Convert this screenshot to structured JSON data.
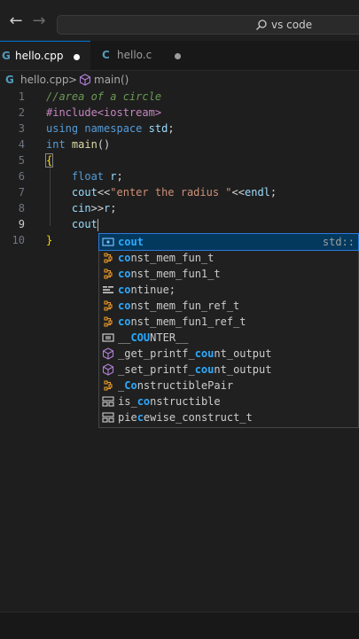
{
  "titlebar": {
    "search_text": "vs code"
  },
  "tabs": [
    {
      "icon": "C++ file icon",
      "label": "hello.cpp",
      "active": true,
      "modified": true
    },
    {
      "icon": "C file icon",
      "label": "hello.c",
      "active": false,
      "modified": true
    }
  ],
  "breadcrumb": {
    "file": "hello.cpp",
    "separator": ">",
    "symbol": "main()"
  },
  "editor": {
    "line_numbers": [
      "1",
      "2",
      "3",
      "4",
      "5",
      "6",
      "7",
      "8",
      "9",
      "10"
    ],
    "current_line": "9",
    "lines": [
      {
        "tokens": [
          {
            "t": "//area of a circle",
            "c": "comment"
          }
        ]
      },
      {
        "tokens": [
          {
            "t": "#include<iostream>",
            "c": "pre"
          }
        ]
      },
      {
        "tokens": [
          {
            "t": "using",
            "c": "kw"
          },
          {
            "t": " ",
            "c": "op"
          },
          {
            "t": "namespace",
            "c": "kw"
          },
          {
            "t": " ",
            "c": "op"
          },
          {
            "t": "std",
            "c": "id"
          },
          {
            "t": ";",
            "c": "op"
          }
        ]
      },
      {
        "tokens": [
          {
            "t": "int",
            "c": "kw"
          },
          {
            "t": " ",
            "c": "op"
          },
          {
            "t": "main",
            "c": "fn"
          },
          {
            "t": "()",
            "c": "op"
          }
        ]
      },
      {
        "tokens": [
          {
            "t": "{",
            "c": "brace"
          }
        ]
      },
      {
        "tokens": [
          {
            "t": "    ",
            "c": "op"
          },
          {
            "t": "float",
            "c": "kw"
          },
          {
            "t": " ",
            "c": "op"
          },
          {
            "t": "r",
            "c": "id"
          },
          {
            "t": ";",
            "c": "op"
          }
        ]
      },
      {
        "tokens": [
          {
            "t": "    ",
            "c": "op"
          },
          {
            "t": "cout",
            "c": "id"
          },
          {
            "t": "<<",
            "c": "op"
          },
          {
            "t": "\"enter the radius \"",
            "c": "str"
          },
          {
            "t": "<<",
            "c": "op"
          },
          {
            "t": "endl",
            "c": "id"
          },
          {
            "t": ";",
            "c": "op"
          }
        ]
      },
      {
        "tokens": [
          {
            "t": "    ",
            "c": "op"
          },
          {
            "t": "cin",
            "c": "id"
          },
          {
            "t": ">>",
            "c": "op"
          },
          {
            "t": "r",
            "c": "id"
          },
          {
            "t": ";",
            "c": "op"
          }
        ]
      },
      {
        "tokens": [
          {
            "t": "    ",
            "c": "op"
          },
          {
            "t": "cout",
            "c": "id"
          }
        ],
        "cursor": true
      },
      {
        "tokens": [
          {
            "t": "}",
            "c": "brace"
          }
        ]
      }
    ]
  },
  "suggest": {
    "items": [
      {
        "icon": "variable-icon",
        "pre": "",
        "hl": "cout",
        "post": "",
        "detail": "std::",
        "selected": true
      },
      {
        "icon": "class-icon",
        "pre": "",
        "hl": "co",
        "post": "nst_mem_fun_t",
        "detail": ""
      },
      {
        "icon": "class-icon",
        "pre": "",
        "hl": "co",
        "post": "nst_mem_fun1_t",
        "detail": ""
      },
      {
        "icon": "keyword-icon",
        "pre": "",
        "hl": "co",
        "post": "ntinue;",
        "detail": ""
      },
      {
        "icon": "class-icon",
        "pre": "",
        "hl": "co",
        "post": "nst_mem_fun_ref_t",
        "detail": ""
      },
      {
        "icon": "class-icon",
        "pre": "",
        "hl": "co",
        "post": "nst_mem_fun1_ref_t",
        "detail": ""
      },
      {
        "icon": "constant-icon",
        "pre": "__",
        "hl": "COU",
        "post": "NTER__",
        "detail": ""
      },
      {
        "icon": "method-icon",
        "pre": "_get_printf_",
        "hl": "cou",
        "post": "nt_output",
        "detail": ""
      },
      {
        "icon": "method-icon",
        "pre": "_set_printf_",
        "hl": "cou",
        "post": "nt_output",
        "detail": ""
      },
      {
        "icon": "class-icon",
        "pre": "_",
        "hl": "Co",
        "post": "nstructiblePair",
        "detail": ""
      },
      {
        "icon": "struct-icon",
        "pre": "is_",
        "hl": "co",
        "post": "nstructible",
        "detail": ""
      },
      {
        "icon": "struct-icon",
        "pre": "pie",
        "hl": "c",
        "post": "ewise_construct_t",
        "detail": ""
      }
    ]
  },
  "colors": {
    "accent": "#0078d4",
    "selection": "#04395e",
    "highlight_match": "#2aaaff"
  }
}
